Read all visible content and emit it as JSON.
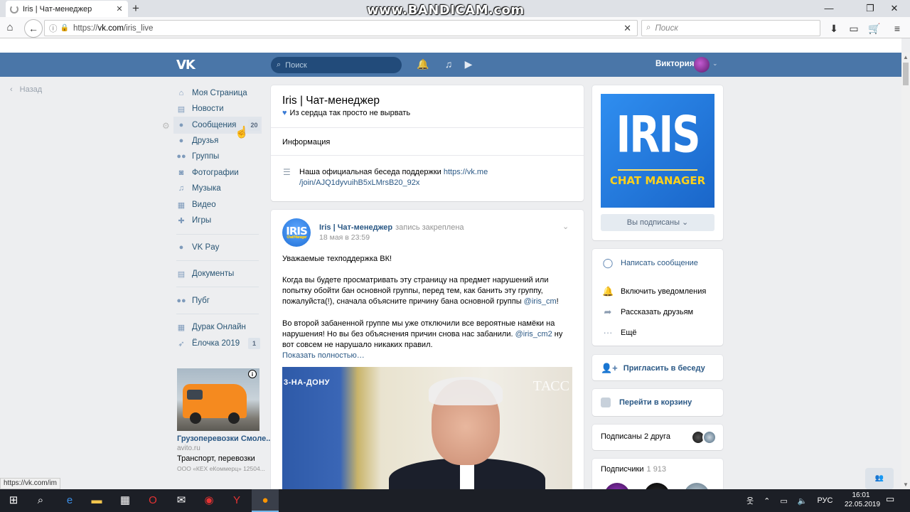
{
  "browser": {
    "tab_title": "Iris | Чат-менеджер",
    "url_scheme": "https://",
    "url_host": "vk.com",
    "url_path": "/iris_live",
    "search_placeholder": "Поиск",
    "watermark": "www.BANDICAM.com",
    "status_url": "https://vk.com/im"
  },
  "vk_header": {
    "search_placeholder": "Поиск",
    "user_name": "Виктория"
  },
  "back_label": "Назад",
  "menu": [
    {
      "label": "Моя Страница",
      "icon": "home-icon"
    },
    {
      "label": "Новости",
      "icon": "news-icon"
    },
    {
      "label": "Сообщения",
      "icon": "messages-icon",
      "count": "20"
    },
    {
      "label": "Друзья",
      "icon": "friends-icon"
    },
    {
      "label": "Группы",
      "icon": "groups-icon"
    },
    {
      "label": "Фотографии",
      "icon": "photo-icon"
    },
    {
      "label": "Музыка",
      "icon": "music-icon"
    },
    {
      "label": "Видео",
      "icon": "video-icon"
    },
    {
      "label": "Игры",
      "icon": "games-icon"
    },
    {
      "label": "VK Pay",
      "icon": "vkpay-icon"
    },
    {
      "label": "Документы",
      "icon": "documents-icon"
    },
    {
      "label": "Пубг",
      "icon": "community-icon"
    },
    {
      "label": "Дурак Онлайн",
      "icon": "app-icon"
    },
    {
      "label": "Ёлочка 2019",
      "icon": "rocket-icon",
      "count": "1"
    }
  ],
  "ad": {
    "title": "Грузоперевозки Смоле...",
    "site": "avito.ru",
    "text": "Транспорт, перевозки",
    "footer": "ООО «КЕХ еКоммерц» 12504..."
  },
  "group": {
    "name": "Iris | Чат-менеджер",
    "status": "Из сердца так просто не вырвать",
    "info_label": "Информация",
    "info_text": "Наша официальная беседа поддержки ",
    "info_link": "https://vk.me/join/AJQ1dyvuihB5xLMrsB20_92x",
    "info_link_line1": "https://vk.me",
    "info_link_line2": "/join/AJQ1dyvuihB5xLMrsB20_92x"
  },
  "post": {
    "avatar_text": "IRIS",
    "avatar_sub": "Chat Manager",
    "author": "Iris | Чат-менеджер",
    "pinned_note": "запись закреплена",
    "date": "18 мая в 23:59",
    "p1": "Уважаемые техподдержка ВК!",
    "p2_a": "Когда вы будете просматривать эту страницу на предмет нарушений или попытку обойти бан основной группы, перед тем, как банить эту группу, пожалуйста(!), сначала объясните причину бана основной группы ",
    "p2_link": "@iris_cm",
    "p2_b": "!",
    "p3_a": "Во второй забаненной группе мы уже отключили все вероятные намёки на нарушения! Но вы без объяснения причин снова нас забанили. ",
    "p3_link": "@iris_cm2",
    "p3_b": " ну вот совсем не нарушало никаких правил.",
    "show_more": "Показать полностью…",
    "image_caption": "3-НА-ДОНУ",
    "image_mark": "ТАСС"
  },
  "sidebar_right": {
    "logo_big": "IRIS",
    "logo_small": "CHAT MANAGER",
    "subscribed": "Вы подписаны",
    "write_message": "Написать сообщение",
    "enable_notifications": "Включить уведомления",
    "tell_friends": "Рассказать друзьям",
    "more": "Ещё",
    "invite_chat": "Пригласить в беседу",
    "go_cart": "Перейти в корзину",
    "friends_subscribed": "Подписаны 2 друга",
    "subscribers_label": "Подписчики",
    "subscribers_count": "1 913"
  },
  "taskbar": {
    "lang": "РУС",
    "time": "16:01",
    "date": "22.05.2019"
  },
  "colors": {
    "vk_blue": "#4a76a8",
    "link": "#2a5885",
    "page_bg": "#edeef0"
  }
}
